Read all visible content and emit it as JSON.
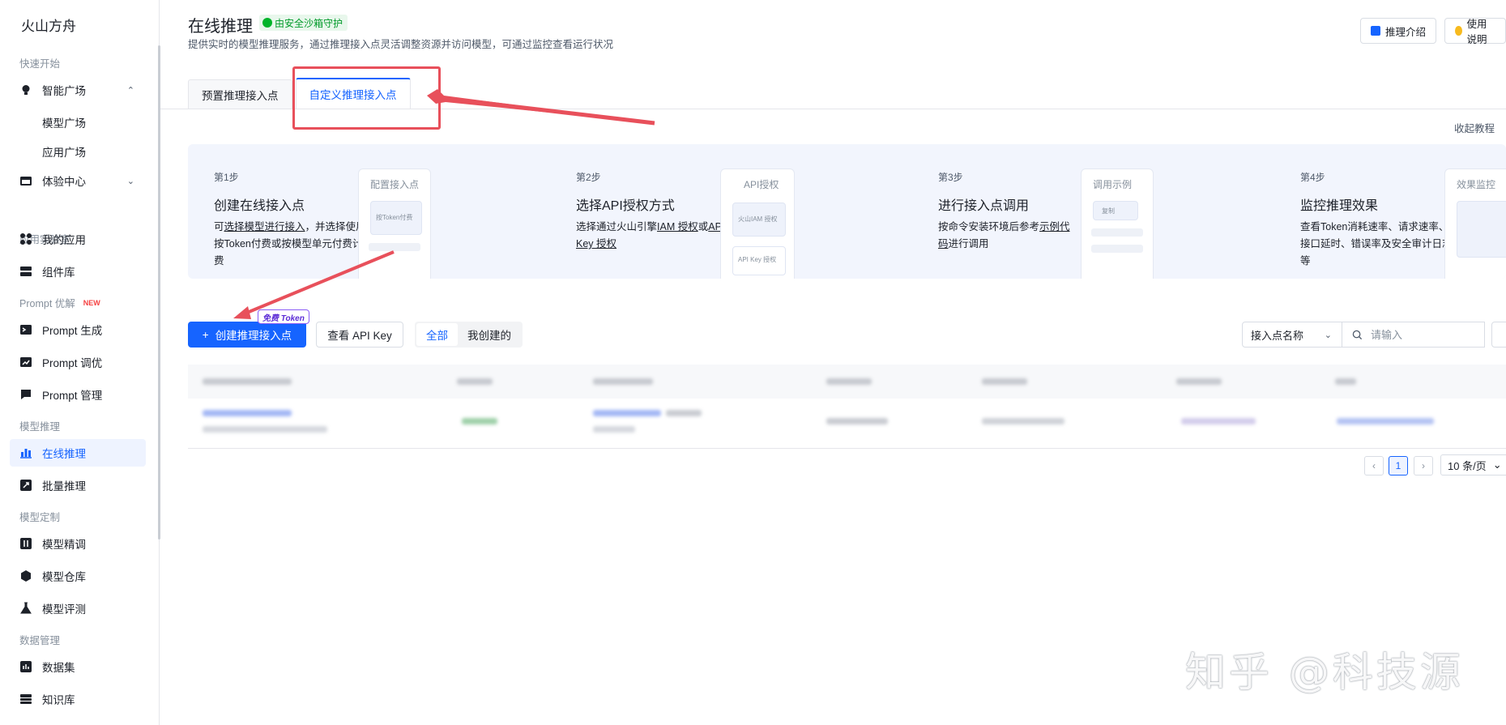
{
  "sidebar": {
    "brand": "火山方舟",
    "sections": {
      "quick_start": "快速开始",
      "app_lab": "应用实验室",
      "prompt": "Prompt 优解",
      "prompt_new": "NEW",
      "model_inference": "模型推理",
      "model_custom": "模型定制",
      "data_mgmt": "数据管理"
    },
    "items": {
      "smart_square": "智能广场",
      "model_square": "模型广场",
      "app_square": "应用广场",
      "experience_center": "体验中心",
      "my_apps": "我的应用",
      "components": "组件库",
      "prompt_generate": "Prompt 生成",
      "prompt_tune": "Prompt 调优",
      "prompt_manage": "Prompt 管理",
      "online_inference": "在线推理",
      "batch_inference": "批量推理",
      "model_finetune": "模型精调",
      "model_repo": "模型仓库",
      "model_eval": "模型评测",
      "datasets": "数据集",
      "knowledge_base": "知识库"
    }
  },
  "header": {
    "title": "在线推理",
    "safe_badge": "由安全沙箱守护",
    "desc": "提供实时的模型推理服务，通过推理接入点灵活调整资源并访问模型，可通过监控查看运行状况",
    "intro_btn": "推理介绍",
    "guide_btn": "使用说明"
  },
  "tabs": {
    "preset": "预置推理接入点",
    "custom": "自定义推理接入点"
  },
  "collapse": "收起教程",
  "steps": [
    {
      "no": "第1步",
      "title": "创建在线接入点",
      "desc_a": "可",
      "desc_link": "选择模型进行接入",
      "desc_b": "，并选择使用按Token付费或按模型单元付费计费",
      "mock_title": "配置接入点",
      "mock_box": "按Token付费"
    },
    {
      "no": "第2步",
      "title": "选择API授权方式",
      "desc_a": "选择通过火山引擎",
      "desc_link": "IAM 授权",
      "desc_b": "或",
      "desc_link2": "API Key 授权",
      "mock_title": "API授权",
      "mock_box": "火山IAM 授权",
      "mock_box2": "API Key 授权"
    },
    {
      "no": "第3步",
      "title": "进行接入点调用",
      "desc_a": "按命令安装环境后参考",
      "desc_link": "示例代码",
      "desc_b": "进行调用",
      "mock_title": "调用示例",
      "mock_box": "复制"
    },
    {
      "no": "第4步",
      "title": "监控推理效果",
      "desc_a": "查看Token消耗速率、请求速率、接口延时、错误率及安全审计日志等",
      "mock_title": "效果监控"
    }
  ],
  "toolbar": {
    "create_btn": "创建推理接入点",
    "free_tag": "免费 Token",
    "apikey_btn": "查看 API Key",
    "seg_all": "全部",
    "seg_mine": "我创建的",
    "filter_label": "接入点名称",
    "search_placeholder": "请输入"
  },
  "pagination": {
    "prev": "‹",
    "page": "1",
    "next": "›",
    "page_size": "10 条/页"
  },
  "watermark": "知乎 @科技源"
}
